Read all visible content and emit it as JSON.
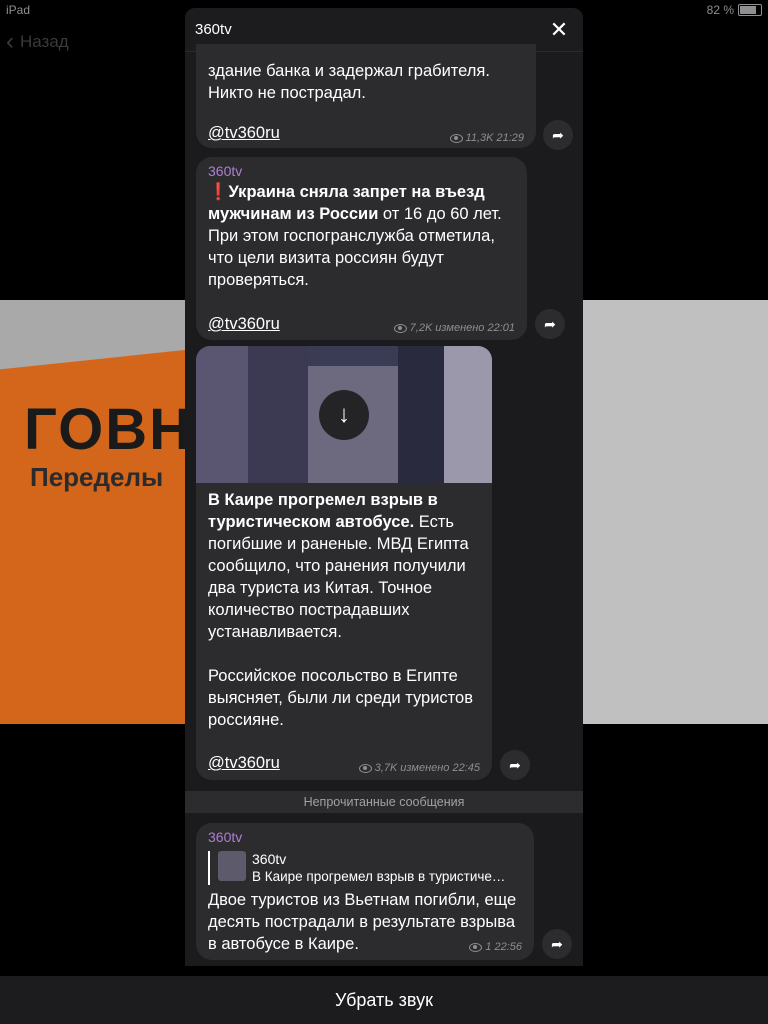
{
  "status": {
    "device": "iPad",
    "battery": "82 %"
  },
  "nav": {
    "back_label": "Назад"
  },
  "background_text": {
    "line1": "ГОВН",
    "line2": "Переделы"
  },
  "modal": {
    "title": "360tv"
  },
  "messages": [
    {
      "text": "здание банка и задержал грабителя. Никто не пострадал.",
      "link": "@tv360ru",
      "views": "11,3K",
      "time": "21:29"
    },
    {
      "sender": "360tv",
      "bold": "❗Украина сняла запрет на въезд мужчинам из России",
      "text": " от 16 до 60 лет. При этом госпогранслужба отметила, что цели визита россиян будут проверяться.",
      "link": "@tv360ru",
      "views": "7,2K",
      "time": "изменено 22:01"
    },
    {
      "bold": "В Каире прогремел взрыв в туристическом автобусе.",
      "text": " Есть погибшие и раненые. МВД Египта сообщило, что ранения получили два туриста из Китая. Точное количество пострадавших устанавливается.",
      "text2": "Российское посольство в Египте выясняет, были ли среди туристов россияне.",
      "link": "@tv360ru",
      "views": "3,7K",
      "time": "изменено 22:45"
    },
    {
      "sender": "360tv",
      "reply_name": "360tv",
      "reply_text": "В Каире прогремел взрыв в туристиче…",
      "text": "Двое туристов из Вьетнам погибли, еще десять пострадали в результате взрыва в автобусе в Каире.",
      "views": "1",
      "time": "22:56"
    }
  ],
  "unread_label": "Непрочитанные сообщения",
  "bottom_action": "Убрать звук"
}
